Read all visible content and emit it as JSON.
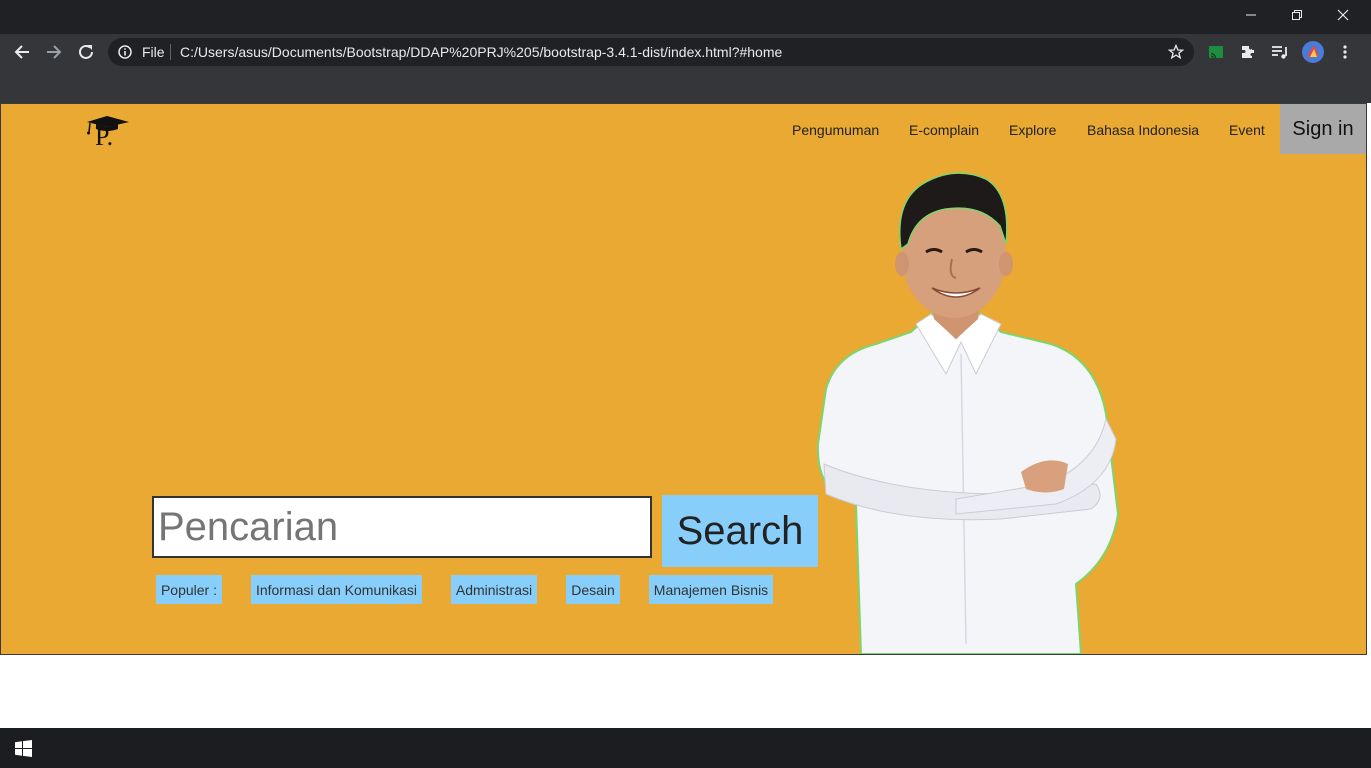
{
  "browser": {
    "omnibox": {
      "scheme_label": "File",
      "url": "C:/Users/asus/Documents/Bootstrap/DDAP%20PRJ%205/bootstrap-3.4.1-dist/index.html?#home"
    },
    "icons": [
      "back-icon",
      "forward-icon",
      "reload-icon",
      "info-icon",
      "star-icon",
      "cast-icon",
      "extensions-icon",
      "media-queue-icon",
      "profile-avatar",
      "menu-icon"
    ]
  },
  "site": {
    "logo_text": "P.",
    "nav": {
      "items": [
        {
          "label": "Pengumuman"
        },
        {
          "label": "E-complain"
        },
        {
          "label": "Explore"
        },
        {
          "label": "Bahasa Indonesia"
        },
        {
          "label": "Event"
        }
      ],
      "signin_label": "Sign in"
    },
    "search": {
      "placeholder": "Pencarian",
      "button_label": "Search"
    },
    "popular": {
      "label": "Populer :",
      "tags": [
        {
          "label": "Informasi dan Komunikasi"
        },
        {
          "label": "Administrasi"
        },
        {
          "label": "Desain"
        },
        {
          "label": "Manajemen Bisnis"
        }
      ]
    }
  },
  "colors": {
    "hero_background": "#e9a933",
    "chip_background": "#87cefa",
    "signin_background": "#a9a9a9",
    "browser_dark": "#202124"
  }
}
